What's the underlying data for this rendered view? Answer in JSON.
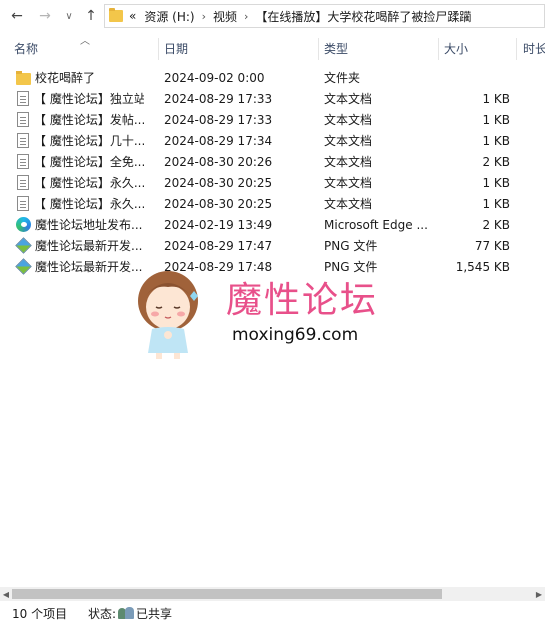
{
  "nav": {
    "back_glyph": "←",
    "forward_glyph": "→",
    "recent_glyph": "∨",
    "up_glyph": "↑"
  },
  "address": {
    "overflow": "«",
    "crumbs": [
      "资源 (H:)",
      "视频",
      "【在线播放】大学校花喝醉了被捡尸蹂躏"
    ],
    "separator": "›"
  },
  "columns": {
    "name": "名称",
    "date": "日期",
    "type": "类型",
    "size": "大小",
    "extra": "时长"
  },
  "files": [
    {
      "name": "校花喝醉了",
      "date": "2024-09-02 0:00",
      "type": "文件夹",
      "size": "",
      "icon": "folder"
    },
    {
      "name": "【 魔性论坛】独立站...",
      "date": "2024-08-29 17:33",
      "type": "文本文档",
      "size": "1 KB",
      "icon": "text"
    },
    {
      "name": "【 魔性论坛】发帖...",
      "date": "2024-08-29 17:33",
      "type": "文本文档",
      "size": "1 KB",
      "icon": "text"
    },
    {
      "name": "【 魔性论坛】几十...",
      "date": "2024-08-29 17:34",
      "type": "文本文档",
      "size": "1 KB",
      "icon": "text"
    },
    {
      "name": "【 魔性论坛】全免...",
      "date": "2024-08-30 20:26",
      "type": "文本文档",
      "size": "2 KB",
      "icon": "text"
    },
    {
      "name": "【 魔性论坛】永久...",
      "date": "2024-08-30 20:25",
      "type": "文本文档",
      "size": "1 KB",
      "icon": "text"
    },
    {
      "name": "【 魔性论坛】永久...",
      "date": "2024-08-30 20:25",
      "type": "文本文档",
      "size": "1 KB",
      "icon": "text"
    },
    {
      "name": "魔性论坛地址发布...",
      "date": "2024-02-19 13:49",
      "type": "Microsoft Edge ...",
      "size": "2 KB",
      "icon": "edge"
    },
    {
      "name": "魔性论坛最新开发...",
      "date": "2024-08-29 17:47",
      "type": "PNG 文件",
      "size": "77 KB",
      "icon": "png"
    },
    {
      "name": "魔性论坛最新开发...",
      "date": "2024-08-29 17:48",
      "type": "PNG 文件",
      "size": "1,545 KB",
      "icon": "png"
    }
  ],
  "watermark": {
    "title": "魔性论坛",
    "url": "moxing69.com"
  },
  "scrollbar": {
    "left_glyph": "◀",
    "right_glyph": "▶"
  },
  "status": {
    "count": "10 个项目",
    "state_label": "状态:",
    "state_value": "已共享"
  }
}
